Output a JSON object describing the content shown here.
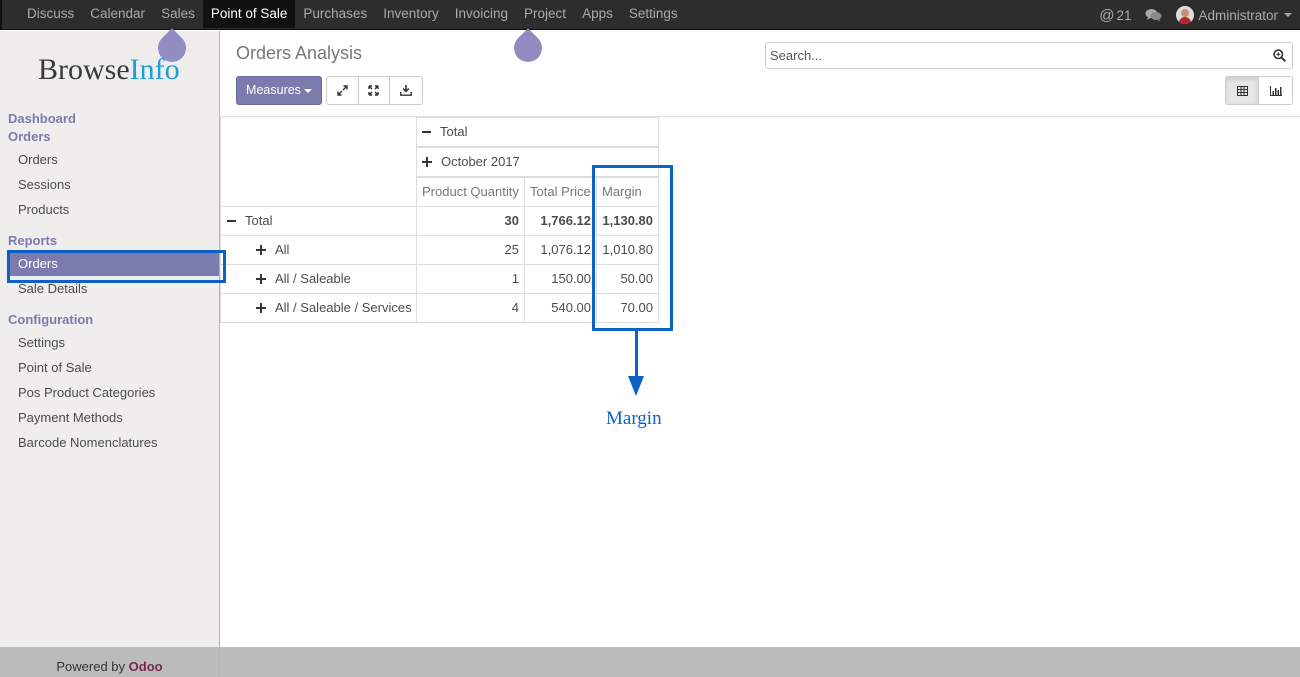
{
  "topbar": {
    "menu": [
      "Discuss",
      "Calendar",
      "Sales",
      "Point of Sale",
      "Purchases",
      "Inventory",
      "Invoicing",
      "Project",
      "Apps",
      "Settings"
    ],
    "active": "Point of Sale",
    "mentions_count": "21",
    "user_name": "Administrator"
  },
  "sidebar": {
    "logo_left": "Browse",
    "logo_right": "Info",
    "sections": {
      "dashboard": "Dashboard",
      "orders": "Orders",
      "reports": "Reports",
      "configuration": "Configuration"
    },
    "orders_items": [
      "Orders",
      "Sessions",
      "Products"
    ],
    "reports_items": [
      "Orders",
      "Sale Details"
    ],
    "config_items": [
      "Settings",
      "Point of Sale",
      "Pos Product Categories",
      "Payment Methods",
      "Barcode Nomenclatures"
    ],
    "powered_by": "Powered by",
    "powered_brand": "Odoo"
  },
  "control": {
    "breadcrumb": "Orders Analysis",
    "search_placeholder": "Search...",
    "measures_label": "Measures"
  },
  "pivot": {
    "col_total": "Total",
    "col_period": "October 2017",
    "measures": [
      "Product Quantity",
      "Total Price",
      "Margin"
    ],
    "rows": [
      {
        "label": "Total",
        "qty": "30",
        "price": "1,766.12",
        "margin": "1,130.80"
      },
      {
        "label": "All",
        "qty": "25",
        "price": "1,076.12",
        "margin": "1,010.80"
      },
      {
        "label": "All / Saleable",
        "qty": "1",
        "price": "150.00",
        "margin": "50.00"
      },
      {
        "label": "All / Saleable / Services",
        "qty": "4",
        "price": "540.00",
        "margin": "70.00"
      }
    ]
  },
  "annotation": {
    "label": "Margin",
    "color": "#0b62c4"
  },
  "colors": {
    "accent": "#7c7bad",
    "topbar": "#2d2d2d"
  }
}
